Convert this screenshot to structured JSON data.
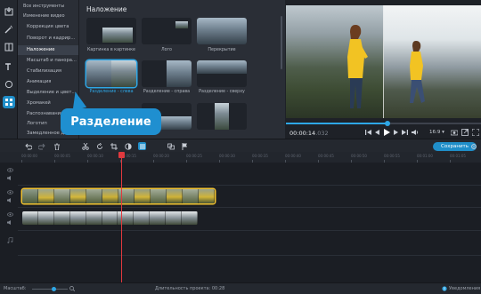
{
  "sidebar": {
    "icons": [
      "import-icon",
      "magic-wand-icon",
      "transitions-icon",
      "titles-icon",
      "stickers-icon",
      "more-tools-icon"
    ]
  },
  "tools": {
    "all_tools": "Все инструменты",
    "group": "Изменение видео",
    "items": [
      "Коррекция цвета",
      "Поворот и кадрир...",
      "Наложение",
      "Масштаб и панора...",
      "Стабилизация",
      "Анимация",
      "Выделение и цвет...",
      "Хромакей",
      "Распознавание",
      "Логотип",
      "Замедленное дв..."
    ],
    "selected_index": 2
  },
  "panel": {
    "title": "Наложение",
    "tiles": [
      "Картинка в картинке",
      "Лого",
      "Перекрытие",
      "Разделение - слева",
      "Разделение - справа",
      "Разделение - сверху",
      "",
      "",
      ""
    ],
    "selected_index": 3
  },
  "callout": {
    "label": "Разделение"
  },
  "player": {
    "time_main": "00:00:14",
    "time_dim": ".032",
    "progress": 0.52,
    "aspect": "16:9 ▾"
  },
  "toolbar": {
    "create_label": "Сохранить"
  },
  "ruler": {
    "labels": [
      "00:00:00",
      "00:00:05",
      "00:00:10",
      "00:00:15",
      "00:00:20",
      "00:00:25",
      "00:00:30",
      "00:00:35",
      "00:00:40",
      "00:00:45",
      "00:00:50",
      "00:00:55",
      "00:01:00",
      "00:01:05",
      "00:01:10"
    ]
  },
  "status": {
    "zoom_label": "Масштаб:",
    "duration": "Длительность проекта: 00:28",
    "notifications": "Уведомления"
  },
  "colors": {
    "accent": "#1f8ec9",
    "selection": "#f2c230",
    "playhead": "#e0393e"
  }
}
